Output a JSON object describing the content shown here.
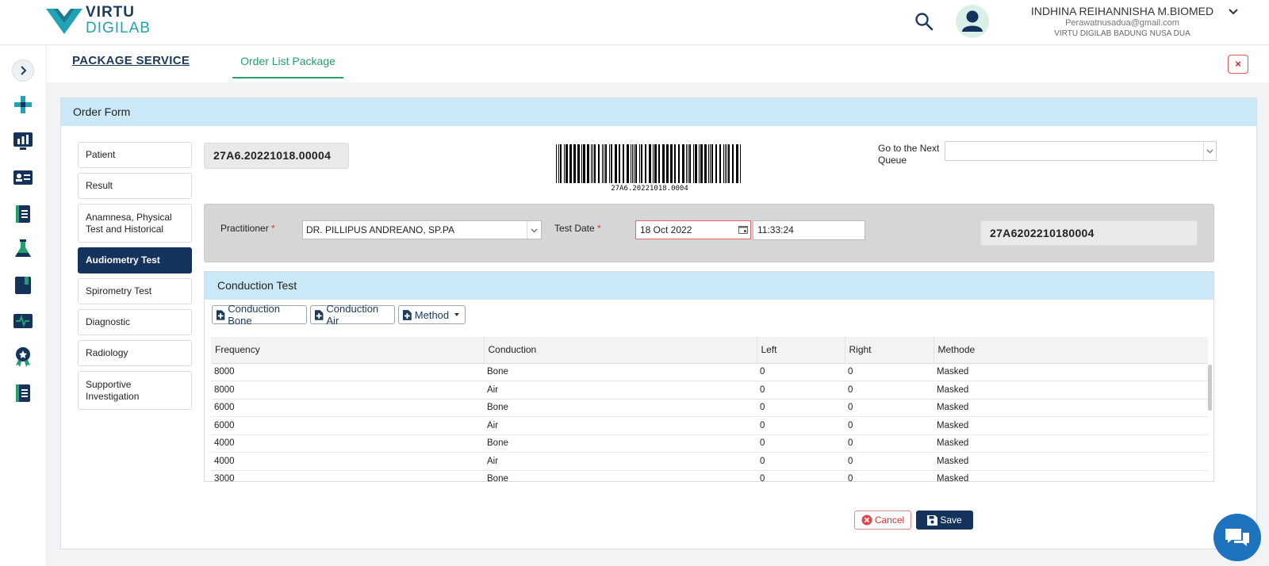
{
  "brand": {
    "line1": "VIRTU",
    "line2": "DIGILAB"
  },
  "user": {
    "name": "INDHINA REIHANNISHA M.BIOMED",
    "email": "Perawatnusadua@gmail.com",
    "org": "VIRTU DIGILAB BADUNG NUSA DUA"
  },
  "tabs": {
    "package": "PACKAGE SERVICE",
    "order_list": "Order List Package"
  },
  "close_label": "×",
  "form": {
    "title": "Order Form",
    "nav": [
      "Patient",
      "Result",
      "Anamnesa, Physical Test and Historical",
      "Audiometry Test",
      "Spirometry Test",
      "Diagnostic",
      "Radiology",
      "Supportive Investigation"
    ],
    "order_number": "27A6.20221018.00004",
    "barcode_text": "27A6.20221018.0004",
    "queue_label": "Go to the Next Queue",
    "practitioner_label": "Practitioner",
    "practitioner_value": "DR. PILLIPUS ANDREANO, SP.PA",
    "test_date_label": "Test Date",
    "test_date_value": "18 Oct 2022",
    "test_time_value": "11:33:24",
    "code": "27A6202210180004",
    "required_mark": "*"
  },
  "conduction": {
    "title": "Conduction Test",
    "buttons": [
      "Conduction Bone",
      "Conduction Air",
      "Method"
    ],
    "columns": [
      "Frequency",
      "Conduction",
      "Left",
      "Right",
      "Methode"
    ],
    "rows": [
      [
        "8000",
        "Bone",
        "0",
        "0",
        "Masked"
      ],
      [
        "8000",
        "Air",
        "0",
        "0",
        "Masked"
      ],
      [
        "6000",
        "Bone",
        "0",
        "0",
        "Masked"
      ],
      [
        "6000",
        "Air",
        "0",
        "0",
        "Masked"
      ],
      [
        "4000",
        "Bone",
        "0",
        "0",
        "Masked"
      ],
      [
        "4000",
        "Air",
        "0",
        "0",
        "Masked"
      ],
      [
        "3000",
        "Bone",
        "0",
        "0",
        "Masked"
      ]
    ]
  },
  "actions": {
    "cancel": "Cancel",
    "save": "Save"
  },
  "colors": {
    "navy": "#14335c",
    "accent_green": "#22a06b",
    "header_blue": "#cbe8f6",
    "chat_blue": "#1e73be"
  },
  "icons": [
    "virtu-logo",
    "search-icon",
    "user-avatar-icon",
    "chevron-down-icon",
    "chevron-right-icon",
    "medical-cross-icon",
    "dashboard-chart-icon",
    "id-card-icon",
    "book-icon",
    "flask-icon",
    "notebook-icon",
    "monitor-pulse-icon",
    "award-icon",
    "book-list-icon",
    "calendar-icon",
    "file-plus-icon",
    "cancel-x-icon",
    "save-disk-icon",
    "chat-icon"
  ]
}
